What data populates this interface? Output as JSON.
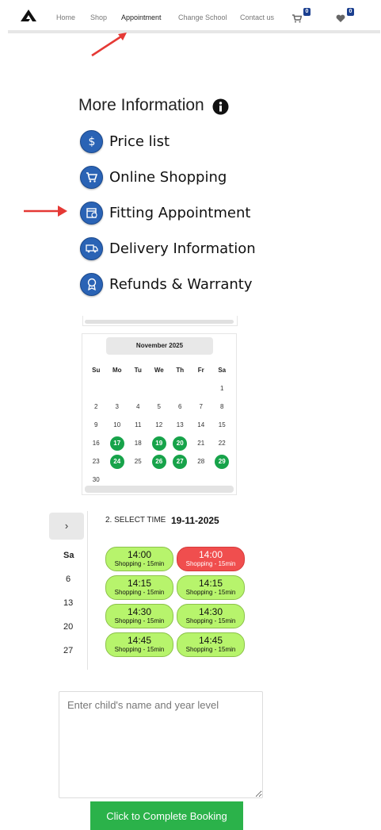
{
  "nav": {
    "links": [
      "Home",
      "Shop",
      "Appointment",
      "Change School",
      "Contact us"
    ],
    "cart_icon": "cart-icon",
    "cart_count": "0",
    "wishlist_icon": "heart-icon",
    "wishlist_count": "0"
  },
  "info": {
    "title": "More Information",
    "items": [
      {
        "label": "Price list",
        "icon": "dollar-icon"
      },
      {
        "label": "Online Shopping",
        "icon": "cart-icon"
      },
      {
        "label": "Fitting Appointment",
        "icon": "calendar-icon"
      },
      {
        "label": "Delivery Information",
        "icon": "truck-icon"
      },
      {
        "label": "Refunds & Warranty",
        "icon": "badge-icon"
      }
    ]
  },
  "calendar": {
    "month": "November 2025",
    "days_of_week": [
      "Su",
      "Mo",
      "Tu",
      "We",
      "Th",
      "Fr",
      "Sa"
    ],
    "weeks": [
      [
        "",
        "",
        "",
        "",
        "",
        "",
        "1"
      ],
      [
        "2",
        "3",
        "4",
        "5",
        "6",
        "7",
        "8"
      ],
      [
        "9",
        "10",
        "11",
        "12",
        "13",
        "14",
        "15"
      ],
      [
        "16",
        "17",
        "18",
        "19",
        "20",
        "21",
        "22"
      ],
      [
        "23",
        "24",
        "25",
        "26",
        "27",
        "28",
        "29"
      ],
      [
        "30",
        "",
        "",
        "",
        "",
        "",
        ""
      ]
    ],
    "available_days": [
      "17",
      "19",
      "20",
      "24",
      "26",
      "27",
      "29"
    ],
    "available_color": "#17a34a"
  },
  "partial_calendar": {
    "next_label": "›",
    "day_header": "Sa",
    "days": [
      "6",
      "13",
      "20",
      "27"
    ]
  },
  "time_selection": {
    "title": "2. SELECT TIME",
    "date": "19-11-2025",
    "slots": [
      {
        "time": "14:00",
        "label": "Shopping - 15min",
        "status": "available"
      },
      {
        "time": "14:00",
        "label": "Shopping - 15min",
        "status": "booked"
      },
      {
        "time": "14:15",
        "label": "Shopping - 15min",
        "status": "available"
      },
      {
        "time": "14:15",
        "label": "Shopping - 15min",
        "status": "available"
      },
      {
        "time": "14:30",
        "label": "Shopping - 15min",
        "status": "available"
      },
      {
        "time": "14:30",
        "label": "Shopping - 15min",
        "status": "available"
      },
      {
        "time": "14:45",
        "label": "Shopping - 15min",
        "status": "available"
      },
      {
        "time": "14:45",
        "label": "Shopping - 15min",
        "status": "available"
      }
    ],
    "available_color": "#b7f46c",
    "booked_color": "#f04e4e"
  },
  "form": {
    "notes_placeholder": "Enter child's name and year level",
    "notes_value": "",
    "submit_label": "Click to Complete Booking",
    "submit_color": "#2bb24a"
  }
}
